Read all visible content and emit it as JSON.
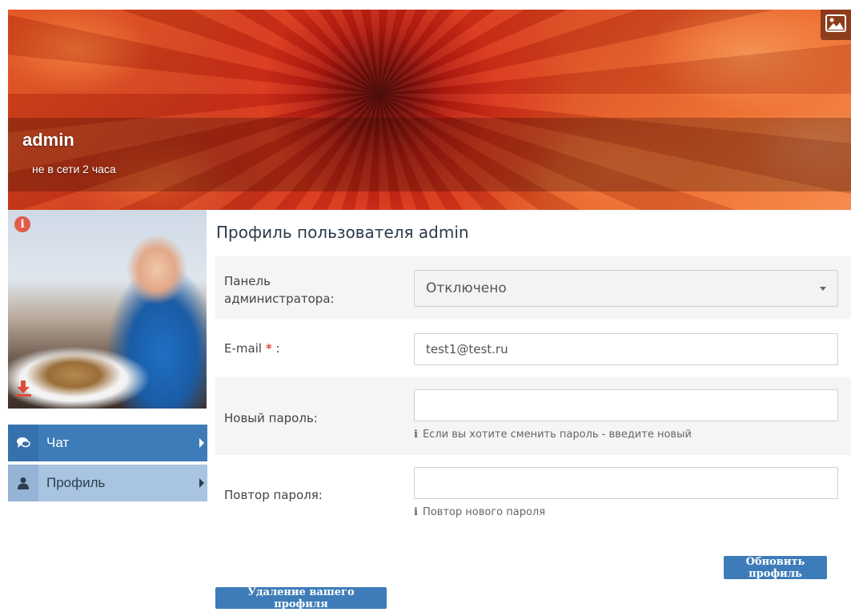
{
  "cover": {
    "username": "admin",
    "status": "не в сети 2 часа",
    "change_cover_icon": "image-icon"
  },
  "avatar": {
    "info_icon": "info-icon",
    "info_glyph": "i",
    "download_icon": "download-icon"
  },
  "sidebar": {
    "items": [
      {
        "label": "Чат",
        "icon": "chat-icon"
      },
      {
        "label": "Профиль",
        "icon": "user-icon"
      }
    ]
  },
  "main": {
    "title": "Профиль пользователя admin",
    "admin_panel": {
      "label": "Панель администратора:",
      "value": "Отключено"
    },
    "email": {
      "label": "E-mail",
      "required_mark": "*",
      "suffix": " :",
      "value": "test1@test.ru"
    },
    "new_password": {
      "label": "Новый пароль:",
      "value": "",
      "hint": "Если вы хотите сменить пароль - введите новый"
    },
    "repeat_password": {
      "label": "Повтор пароля:",
      "value": "",
      "hint": "Повтор нового пароля"
    },
    "hint_icon_glyph": "i",
    "update_button": "Обновить профиль",
    "delete_button": "Удаление вашего профиля"
  },
  "colors": {
    "accent": "#3d7cb8",
    "nav_active": "#3d7cb8",
    "nav_inactive": "#a8c4e0",
    "required": "#e0483a"
  }
}
